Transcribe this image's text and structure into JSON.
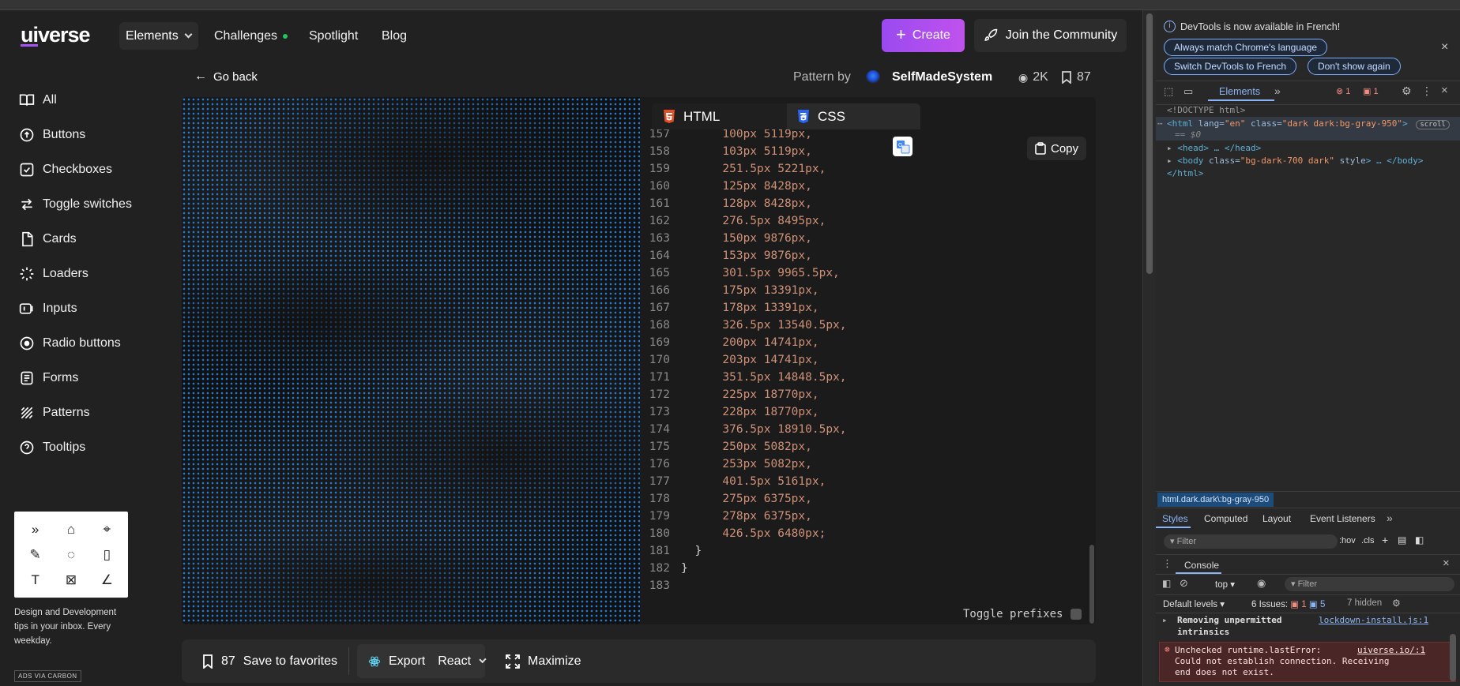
{
  "nav": {
    "logo": "uiverse",
    "logo_u": "ui",
    "logo_rest": "verse",
    "links": [
      "Elements",
      "Challenges",
      "Spotlight",
      "Blog"
    ],
    "create_label": "Create",
    "join_label": "Join the Community"
  },
  "sidebar": {
    "items": [
      {
        "label": "All",
        "icon": "book-icon"
      },
      {
        "label": "Buttons",
        "icon": "button-icon"
      },
      {
        "label": "Checkboxes",
        "icon": "checkbox-icon"
      },
      {
        "label": "Toggle switches",
        "icon": "toggle-icon"
      },
      {
        "label": "Cards",
        "icon": "card-icon"
      },
      {
        "label": "Loaders",
        "icon": "loader-icon"
      },
      {
        "label": "Inputs",
        "icon": "input-icon"
      },
      {
        "label": "Radio buttons",
        "icon": "radio-icon"
      },
      {
        "label": "Forms",
        "icon": "form-icon"
      },
      {
        "label": "Patterns",
        "icon": "pattern-icon"
      },
      {
        "label": "Tooltips",
        "icon": "tooltip-icon"
      }
    ],
    "ad_text": "Design and Development tips in your inbox. Every weekday.",
    "ad_via": "ADS VIA CARBON"
  },
  "header": {
    "go_back": "Go back",
    "pattern_by": "Pattern by",
    "author": "SelfMadeSystem",
    "views": "2K",
    "saves": "87"
  },
  "code_panel": {
    "tabs": [
      "HTML",
      "CSS"
    ],
    "copy_label": "Copy",
    "toggle_prefixes": "Toggle prefixes",
    "lines": [
      {
        "n": "157",
        "t": "      100px 5119px,"
      },
      {
        "n": "158",
        "t": "      103px 5119px,"
      },
      {
        "n": "159",
        "t": "      251.5px 5221px,"
      },
      {
        "n": "160",
        "t": "      125px 8428px,"
      },
      {
        "n": "161",
        "t": "      128px 8428px,"
      },
      {
        "n": "162",
        "t": "      276.5px 8495px,"
      },
      {
        "n": "163",
        "t": "      150px 9876px,"
      },
      {
        "n": "164",
        "t": "      153px 9876px,"
      },
      {
        "n": "165",
        "t": "      301.5px 9965.5px,"
      },
      {
        "n": "166",
        "t": "      175px 13391px,"
      },
      {
        "n": "167",
        "t": "      178px 13391px,"
      },
      {
        "n": "168",
        "t": "      326.5px 13540.5px,"
      },
      {
        "n": "169",
        "t": "      200px 14741px,"
      },
      {
        "n": "170",
        "t": "      203px 14741px,"
      },
      {
        "n": "171",
        "t": "      351.5px 14848.5px,"
      },
      {
        "n": "172",
        "t": "      225px 18770px,"
      },
      {
        "n": "173",
        "t": "      228px 18770px,"
      },
      {
        "n": "174",
        "t": "      376.5px 18910.5px,"
      },
      {
        "n": "175",
        "t": "      250px 5082px,"
      },
      {
        "n": "176",
        "t": "      253px 5082px,"
      },
      {
        "n": "177",
        "t": "      401.5px 5161px,"
      },
      {
        "n": "178",
        "t": "      275px 6375px,"
      },
      {
        "n": "179",
        "t": "      278px 6375px,"
      },
      {
        "n": "180",
        "t": "      426.5px 6480px;"
      },
      {
        "n": "181",
        "t": "  }"
      },
      {
        "n": "182",
        "t": "}"
      },
      {
        "n": "183",
        "t": ""
      }
    ]
  },
  "actions": {
    "save_count": "87",
    "save_label": "Save to favorites",
    "export_label": "Export",
    "framework": "React",
    "maximize_label": "Maximize"
  },
  "devtools": {
    "banner": "DevTools is now available in French!",
    "btn_match": "Always match Chrome's language",
    "btn_switch": "Switch DevTools to French",
    "btn_dont": "Don't show again",
    "elements_tab": "Elements",
    "err_count": "1",
    "warn_count": "1",
    "doctype": "<!DOCTYPE html>",
    "html_open": "<html",
    "html_lang_attr": " lang=",
    "html_lang_val": "\"en\"",
    "html_class_attr": " class=",
    "html_class_val": "\"dark dark:bg-gray-950\"",
    "html_gt": ">",
    "scroll_badge": "scroll",
    "eq_dollar": "== $0",
    "head_line": "<head> … </head>",
    "body_open": "<body",
    "body_class_attr": " class=",
    "body_class_val": "\"bg-dark-700 dark\"",
    "body_style_attr": " style",
    "body_close": "> … </body>",
    "html_close": "</html>",
    "breadcrumb": "html.dark.dark\\:bg-gray-950",
    "styles_tabs": [
      "Styles",
      "Computed",
      "Layout",
      "Event Listeners"
    ],
    "filter_placeholder": "Filter",
    "hov": ":hov",
    "cls": ".cls",
    "console_tab": "Console",
    "context": "top",
    "console_filter": "Filter",
    "default_levels": "Default levels",
    "issues_label": "6 Issues:",
    "issues_err": "1",
    "issues_info": "5",
    "hidden": "7 hidden",
    "msg1_line1": "Removing unpermitted",
    "msg1_line2": "intrinsics",
    "msg1_src": "lockdown-install.js:1",
    "msg2_line1": "Unchecked runtime.lastError:",
    "msg2_src": "uiverse.io/:1",
    "msg2_rest": "Could not establish connection. Receiving end does not exist."
  },
  "colors": {
    "accent_purple": "#a855f7",
    "pattern_blue": "#1e7fe0",
    "code_value": "#ce9178",
    "success_dot": "#22c55e"
  }
}
